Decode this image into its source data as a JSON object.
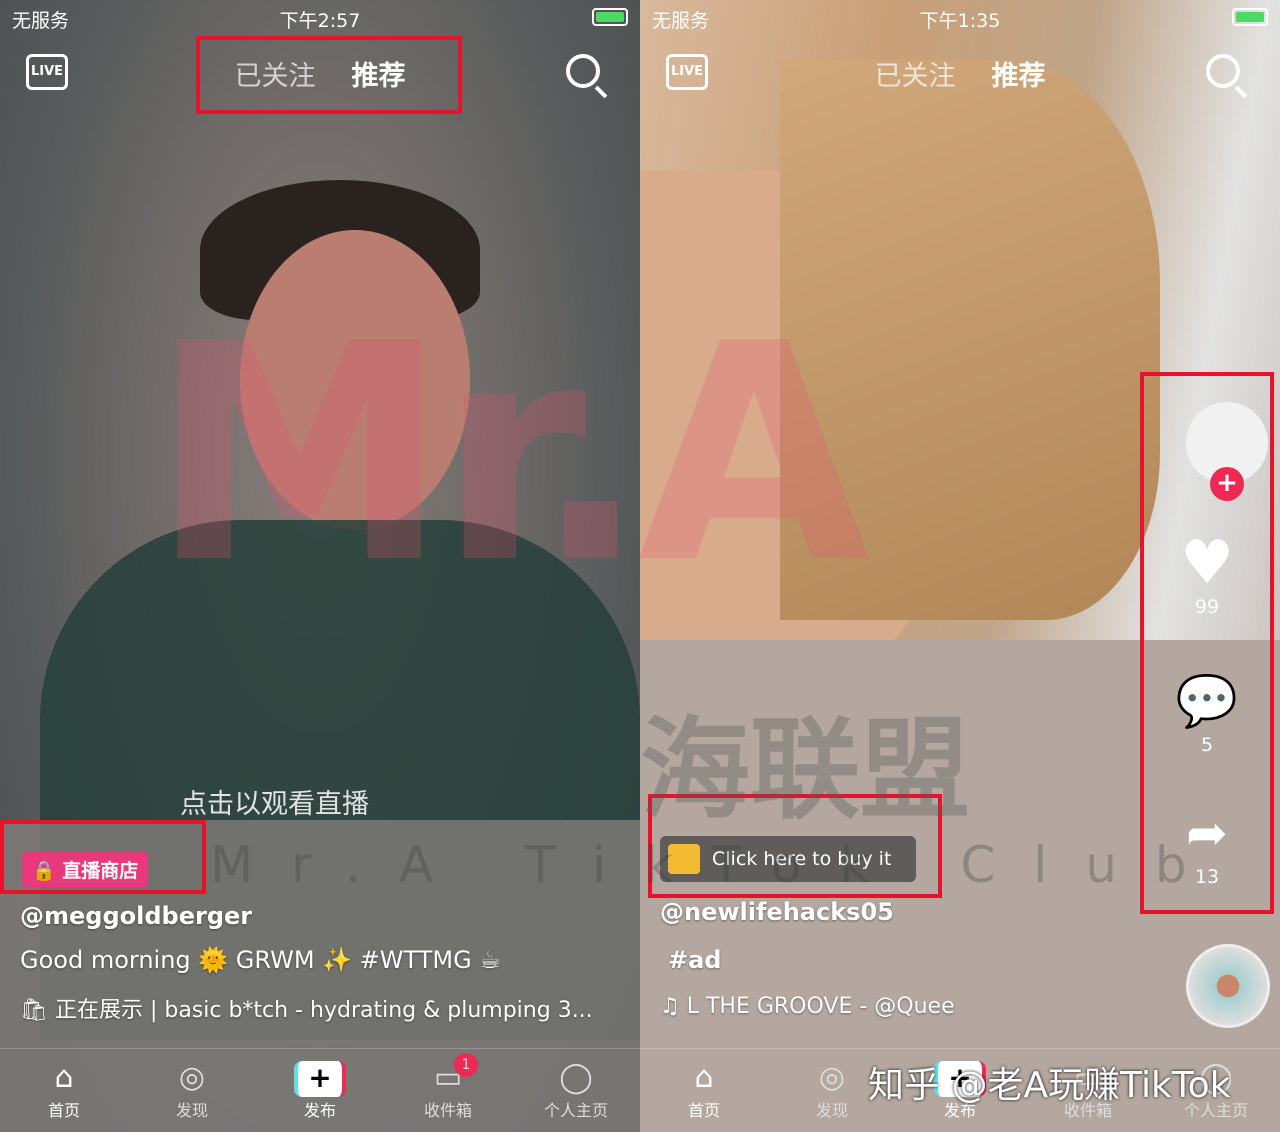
{
  "left": {
    "status": {
      "carrier": "无服务",
      "time": "下午2:57"
    },
    "nav": {
      "live": "LIVE",
      "following": "已关注",
      "for_you": "推荐"
    },
    "live_hint": "点击以观看直播",
    "shop_badge": "直播商店",
    "username": "@meggoldberger",
    "caption": "Good morning 🌞 GRWM ✨ #WTTMG ☕",
    "showcase": {
      "label": "正在展示",
      "product": "basic b*tch - hydrating & plumping 3..."
    },
    "tabbar": [
      "首页",
      "发现",
      "发布",
      "收件箱",
      "个人主页"
    ],
    "inbox_badge": "1"
  },
  "right": {
    "status": {
      "carrier": "无服务",
      "time": "下午1:35"
    },
    "nav": {
      "live": "LIVE",
      "following": "已关注",
      "for_you": "推荐"
    },
    "buy_button": "Click here to buy it",
    "username": "@newlifehacks05",
    "caption": "#ad",
    "sound": "L THE GROOVE - @Quee",
    "likes": "99",
    "comments": "5",
    "shares": "13",
    "tabbar": [
      "首页",
      "发现",
      "发布",
      "收件箱",
      "个人主页"
    ]
  },
  "watermarks": {
    "logo": "Mr.A",
    "club": "Mr.A TikTok Club",
    "cn": "海联盟",
    "zhihu": "知乎 @老A玩赚TikTok"
  },
  "colors": {
    "highlight": "#e8132a",
    "shop": "#e8397a",
    "buy": "#f2bb32",
    "accent": "#ee2a54"
  }
}
